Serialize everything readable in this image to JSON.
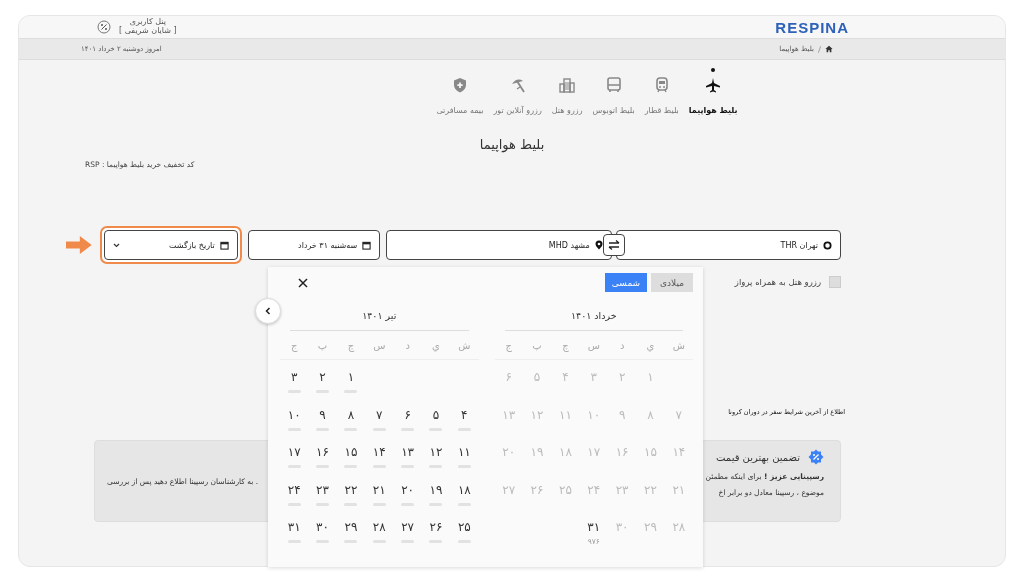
{
  "header": {
    "logo": "RESPINA",
    "user_panel": "پنل کاربری",
    "user_name": "[ شایان شریفی ]"
  },
  "breadcrumb": {
    "items": [
      "بلیط هواپیما"
    ],
    "date": "امروز دوشنبه ۲ خرداد ۱۴۰۱"
  },
  "services": [
    {
      "kind": "plane",
      "label": "بلیط هواپیما",
      "selected": true
    },
    {
      "kind": "train",
      "label": "بلیط قطار",
      "selected": false
    },
    {
      "kind": "bus",
      "label": "بلیط اتوبوس",
      "selected": false
    },
    {
      "kind": "hotel",
      "label": "رزرو هتل",
      "selected": false
    },
    {
      "kind": "tour",
      "label": "رزرو آنلاین تور",
      "selected": false
    },
    {
      "kind": "insurance",
      "label": "بیمه مسافرتی",
      "selected": false
    }
  ],
  "title": "بلیط هواپیما",
  "discount": "کد تخفیف خرید بلیط هواپیما : RSP",
  "search": {
    "origin": "تهران THR",
    "destination": "مشهد MHD",
    "departure": "سه‌شنبه ۳۱ خرداد",
    "return": {
      "placeholder": "تاریخ بازگشت",
      "highlighted": true
    }
  },
  "hotel_option": {
    "label": "رزرو هتل به همراه پرواز",
    "checked": false
  },
  "calendar": {
    "modes": [
      {
        "label": "میلادی",
        "selected": false
      },
      {
        "label": "شمسی",
        "selected": true
      }
    ],
    "months": [
      {
        "title": "خرداد ۱۴۰۱",
        "weekdays": [
          "ش",
          "ي",
          "د",
          "س",
          "چ",
          "پ",
          "ج"
        ],
        "weeks": [
          [
            {
              "day": "۱",
              "disabled": true,
              "loading": false
            },
            {
              "day": "۲",
              "disabled": true,
              "loading": false
            },
            {
              "day": "۳",
              "disabled": true,
              "loading": false
            },
            {
              "day": "۴",
              "disabled": true,
              "loading": false
            },
            {
              "day": "۵",
              "disabled": true,
              "loading": false
            },
            {
              "day": "۶",
              "disabled": true,
              "loading": false
            }
          ],
          [
            {
              "day": "۷",
              "disabled": true,
              "loading": false
            },
            {
              "day": "۸",
              "disabled": true,
              "loading": false
            },
            {
              "day": "۹",
              "disabled": true,
              "loading": false
            },
            {
              "day": "۱۰",
              "disabled": true,
              "loading": false
            },
            {
              "day": "۱۱",
              "disabled": true,
              "loading": false
            },
            {
              "day": "۱۲",
              "disabled": true,
              "loading": false
            },
            {
              "day": "۱۳",
              "disabled": true,
              "loading": false
            }
          ],
          [
            {
              "day": "۱۴",
              "disabled": true,
              "loading": false
            },
            {
              "day": "۱۵",
              "disabled": true,
              "loading": false
            },
            {
              "day": "۱۶",
              "disabled": true,
              "loading": false
            },
            {
              "day": "۱۷",
              "disabled": true,
              "loading": false
            },
            {
              "day": "۱۸",
              "disabled": true,
              "loading": false
            },
            {
              "day": "۱۹",
              "disabled": true,
              "loading": false
            },
            {
              "day": "۲۰",
              "disabled": true,
              "loading": false
            }
          ],
          [
            {
              "day": "۲۱",
              "disabled": true,
              "loading": false
            },
            {
              "day": "۲۲",
              "disabled": true,
              "loading": false
            },
            {
              "day": "۲۳",
              "disabled": true,
              "loading": false
            },
            {
              "day": "۲۴",
              "disabled": true,
              "loading": false
            },
            {
              "day": "۲۵",
              "disabled": true,
              "loading": false
            },
            {
              "day": "۲۶",
              "disabled": true,
              "loading": false
            },
            {
              "day": "۲۷",
              "disabled": true,
              "loading": false
            }
          ],
          [
            {
              "day": "۲۸",
              "disabled": true,
              "loading": false
            },
            {
              "day": "۲۹",
              "disabled": true,
              "loading": false
            },
            {
              "day": "۳۰",
              "disabled": true,
              "loading": false
            },
            {
              "day": "۳۱",
              "disabled": false,
              "loading": false,
              "price": "۹۷۶"
            }
          ]
        ]
      },
      {
        "title": "تیر ۱۴۰۱",
        "weekdays": [
          "ش",
          "ي",
          "د",
          "س",
          "چ",
          "پ",
          "ج"
        ],
        "weeks": [
          [
            {
              "day": "۱",
              "disabled": false,
              "loading": true
            },
            {
              "day": "۲",
              "disabled": false,
              "loading": true
            },
            {
              "day": "۳",
              "disabled": false,
              "loading": true
            }
          ],
          [
            {
              "day": "۴",
              "disabled": false,
              "loading": true
            },
            {
              "day": "۵",
              "disabled": false,
              "loading": true
            },
            {
              "day": "۶",
              "disabled": false,
              "loading": true
            },
            {
              "day": "۷",
              "disabled": false,
              "loading": true
            },
            {
              "day": "۸",
              "disabled": false,
              "loading": true
            },
            {
              "day": "۹",
              "disabled": false,
              "loading": true
            },
            {
              "day": "۱۰",
              "disabled": false,
              "loading": true
            }
          ],
          [
            {
              "day": "۱۱",
              "disabled": false,
              "loading": true
            },
            {
              "day": "۱۲",
              "disabled": false,
              "loading": true
            },
            {
              "day": "۱۳",
              "disabled": false,
              "loading": true
            },
            {
              "day": "۱۴",
              "disabled": false,
              "loading": true
            },
            {
              "day": "۱۵",
              "disabled": false,
              "loading": true
            },
            {
              "day": "۱۶",
              "disabled": false,
              "loading": true
            },
            {
              "day": "۱۷",
              "disabled": false,
              "loading": true
            }
          ],
          [
            {
              "day": "۱۸",
              "disabled": false,
              "loading": true
            },
            {
              "day": "۱۹",
              "disabled": false,
              "loading": true
            },
            {
              "day": "۲۰",
              "disabled": false,
              "loading": true
            },
            {
              "day": "۲۱",
              "disabled": false,
              "loading": true
            },
            {
              "day": "۲۲",
              "disabled": false,
              "loading": true
            },
            {
              "day": "۲۳",
              "disabled": false,
              "loading": true
            },
            {
              "day": "۲۴",
              "disabled": false,
              "loading": true
            }
          ],
          [
            {
              "day": "۲۵",
              "disabled": false,
              "loading": true
            },
            {
              "day": "۲۶",
              "disabled": false,
              "loading": true
            },
            {
              "day": "۲۷",
              "disabled": false,
              "loading": true
            },
            {
              "day": "۲۸",
              "disabled": false,
              "loading": true
            },
            {
              "day": "۲۹",
              "disabled": false,
              "loading": true
            },
            {
              "day": "۳۰",
              "disabled": false,
              "loading": true
            },
            {
              "day": "۳۱",
              "disabled": false,
              "loading": true
            }
          ]
        ]
      }
    ]
  },
  "corona_link": "اطلاع از آخرین شرایط سفر در دوران کرونا",
  "info": {
    "title": "تضمین بهترین قیمت",
    "text_lines": [
      "**رسپینایی عزیز !** برای اینکه مطمئن",
      "موضوع ، رسپینا معادل دو برابر اخ"
    ],
    "text_fragment": ". به کارشناسان رسپینا اطلاع دهید پس از بررسی"
  }
}
